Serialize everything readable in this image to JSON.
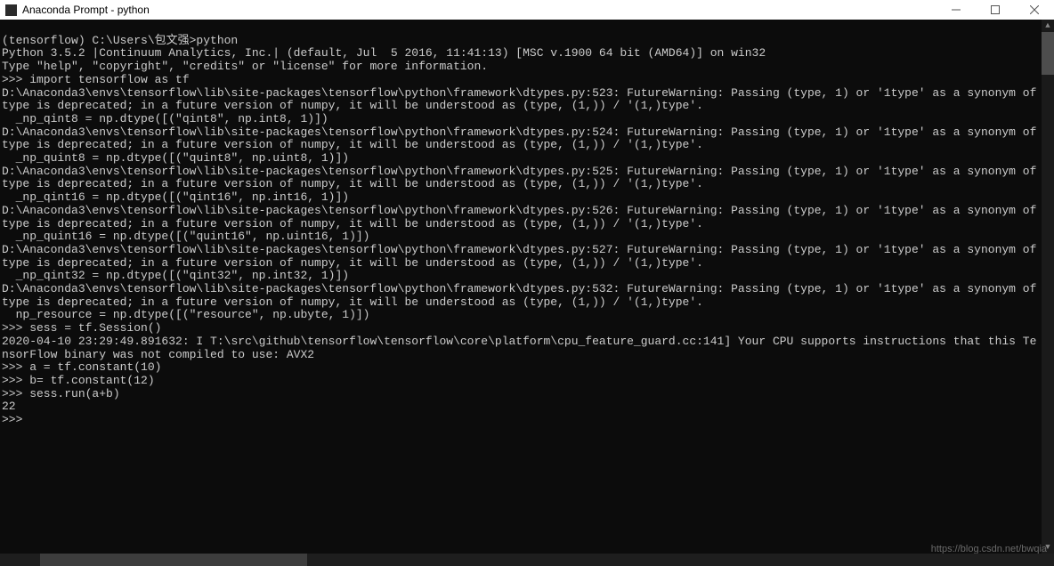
{
  "window": {
    "title": "Anaconda Prompt - python"
  },
  "terminal": {
    "lines": [
      "",
      "(tensorflow) C:\\Users\\包文强>python",
      "Python 3.5.2 |Continuum Analytics, Inc.| (default, Jul  5 2016, 11:41:13) [MSC v.1900 64 bit (AMD64)] on win32",
      "Type \"help\", \"copyright\", \"credits\" or \"license\" for more information.",
      ">>> import tensorflow as tf",
      "D:\\Anaconda3\\envs\\tensorflow\\lib\\site-packages\\tensorflow\\python\\framework\\dtypes.py:523: FutureWarning: Passing (type, 1) or '1type' as a synonym of type is deprecated; in a future version of numpy, it will be understood as (type, (1,)) / '(1,)type'.",
      "  _np_qint8 = np.dtype([(\"qint8\", np.int8, 1)])",
      "D:\\Anaconda3\\envs\\tensorflow\\lib\\site-packages\\tensorflow\\python\\framework\\dtypes.py:524: FutureWarning: Passing (type, 1) or '1type' as a synonym of type is deprecated; in a future version of numpy, it will be understood as (type, (1,)) / '(1,)type'.",
      "  _np_quint8 = np.dtype([(\"quint8\", np.uint8, 1)])",
      "D:\\Anaconda3\\envs\\tensorflow\\lib\\site-packages\\tensorflow\\python\\framework\\dtypes.py:525: FutureWarning: Passing (type, 1) or '1type' as a synonym of type is deprecated; in a future version of numpy, it will be understood as (type, (1,)) / '(1,)type'.",
      "  _np_qint16 = np.dtype([(\"qint16\", np.int16, 1)])",
      "D:\\Anaconda3\\envs\\tensorflow\\lib\\site-packages\\tensorflow\\python\\framework\\dtypes.py:526: FutureWarning: Passing (type, 1) or '1type' as a synonym of type is deprecated; in a future version of numpy, it will be understood as (type, (1,)) / '(1,)type'.",
      "  _np_quint16 = np.dtype([(\"quint16\", np.uint16, 1)])",
      "D:\\Anaconda3\\envs\\tensorflow\\lib\\site-packages\\tensorflow\\python\\framework\\dtypes.py:527: FutureWarning: Passing (type, 1) or '1type' as a synonym of type is deprecated; in a future version of numpy, it will be understood as (type, (1,)) / '(1,)type'.",
      "  _np_qint32 = np.dtype([(\"qint32\", np.int32, 1)])",
      "D:\\Anaconda3\\envs\\tensorflow\\lib\\site-packages\\tensorflow\\python\\framework\\dtypes.py:532: FutureWarning: Passing (type, 1) or '1type' as a synonym of type is deprecated; in a future version of numpy, it will be understood as (type, (1,)) / '(1,)type'.",
      "  np_resource = np.dtype([(\"resource\", np.ubyte, 1)])",
      ">>> sess = tf.Session()",
      "2020-04-10 23:29:49.891632: I T:\\src\\github\\tensorflow\\tensorflow\\core\\platform\\cpu_feature_guard.cc:141] Your CPU supports instructions that this TensorFlow binary was not compiled to use: AVX2",
      ">>> a = tf.constant(10)",
      ">>> b= tf.constant(12)",
      ">>> sess.run(a+b)",
      "22",
      ">>>"
    ]
  },
  "watermark": "https://blog.csdn.net/bwqia"
}
